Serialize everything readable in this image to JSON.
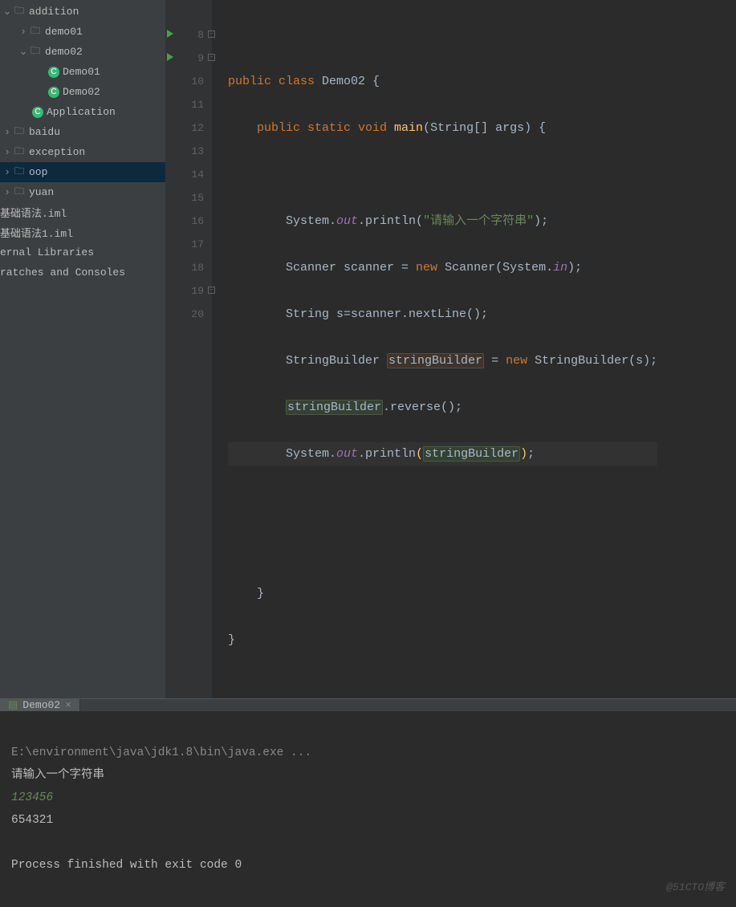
{
  "tree": {
    "addition": "addition",
    "demo01": "demo01",
    "demo02": "demo02",
    "Demo01cls": "Demo01",
    "Demo02cls": "Demo02",
    "Application": "Application",
    "baidu": "baidu",
    "exception": "exception",
    "oop": "oop",
    "yuan": "yuan",
    "iml1": "基础语法.iml",
    "iml2": "基础语法1.iml",
    "ext": "ernal Libraries",
    "scratch": "ratches and Consoles"
  },
  "gutter": [
    "",
    "8",
    "9",
    "10",
    "11",
    "12",
    "13",
    "14",
    "15",
    "16",
    "17",
    "18",
    "19",
    "20"
  ],
  "code": {
    "l1": {
      "a": "public class ",
      "b": "Demo02 {"
    },
    "l2": {
      "a": "public static void ",
      "b": "main",
      "c": "(String[] args) {"
    },
    "l3": {
      "a": "System.",
      "b": "out",
      "c": ".println(",
      "d": "\"请输入一个字符串\"",
      "e": ");"
    },
    "l4": {
      "a": "Scanner scanner = ",
      "b": "new ",
      "c": "Scanner(System.",
      "d": "in",
      "e": ");"
    },
    "l5": {
      "a": "String s=scanner.nextLine();"
    },
    "l6": {
      "a": "StringBuilder ",
      "b": "stringBuilder",
      "c": " = ",
      "d": "new ",
      "e": "StringBuilder(s);"
    },
    "l7": {
      "a": "stringBuilder",
      "b": ".reverse();"
    },
    "l8": {
      "a": "System.",
      "b": "out",
      "c": ".println",
      "d": "(",
      "e": "stringBuilder",
      "f": ")",
      "g": ";"
    },
    "close1": "}",
    "close2": "}"
  },
  "console": {
    "tab": "Demo02",
    "cmd": "E:\\environment\\java\\jdk1.8\\bin\\java.exe ...",
    "prompt": "请输入一个字符串",
    "input": "123456",
    "output": "654321",
    "exit": "Process finished with exit code 0"
  },
  "watermark": "@51CTO博客"
}
